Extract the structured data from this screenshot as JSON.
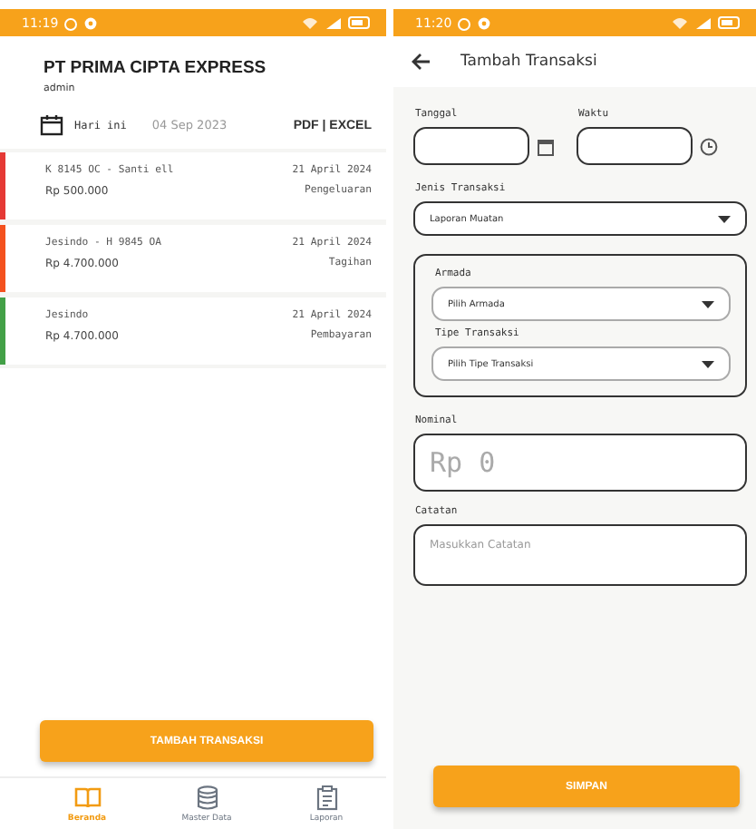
{
  "list_screen": {
    "status_bar": {
      "time": "11:19"
    },
    "company": "PT PRIMA CIPTA EXPRESS",
    "user": "admin",
    "filter": {
      "label": "Hari ini",
      "date": "04 Sep 2023",
      "export": "PDF | EXCEL"
    },
    "transactions": [
      {
        "title": "K 8145 OC - Santi ell",
        "date": "21 April 2024",
        "amount": "Rp 500.000",
        "type": "Pengeluaran",
        "color": "#e53935"
      },
      {
        "title": "Jesindo - H 9845 OA",
        "date": "21 April 2024",
        "amount": "Rp 4.700.000",
        "type": "Tagihan",
        "color": "#f4511e"
      },
      {
        "title": "Jesindo",
        "date": "21 April 2024",
        "amount": "Rp 4.700.000",
        "type": "Pembayaran",
        "color": "#43a047"
      }
    ],
    "add_button": "TAMBAH TRANSAKSI",
    "nav": [
      {
        "label": "Beranda",
        "selected": true
      },
      {
        "label": "Master Data",
        "selected": false
      },
      {
        "label": "Laporan",
        "selected": false
      }
    ]
  },
  "form_screen": {
    "status_bar": {
      "time": "11:20"
    },
    "title": "Tambah Transaksi",
    "date_label": "Tanggal",
    "time_label": "Waktu",
    "type_label": "Jenis Transaksi",
    "type_value": "Laporan Muatan",
    "group": [
      {
        "label": "Armada",
        "value": "Pilih Armada"
      },
      {
        "label": "Tipe Transaksi",
        "value": "Pilih Tipe Transaksi"
      }
    ],
    "nominal_label": "Nominal",
    "nominal_placeholder": "Rp 0",
    "note_label": "Catatan",
    "note_placeholder": "Masukkan Catatan",
    "save_button": "SIMPAN"
  }
}
